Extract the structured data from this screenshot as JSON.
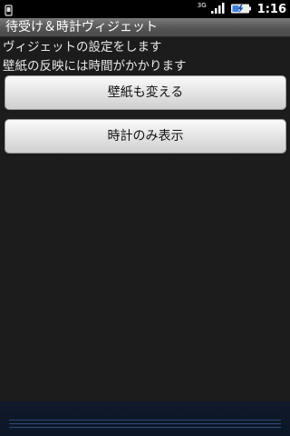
{
  "status_bar": {
    "network_type": "3G",
    "time": "1:16",
    "icons": [
      "notification-icon",
      "signal-icon",
      "battery-charging-icon"
    ]
  },
  "title": "待受け＆時計ヴィジェット",
  "description": {
    "line1": "ヴィジェットの設定をします",
    "line2": "壁紙の反映には時間がかかります"
  },
  "buttons": {
    "change_wallpaper": "壁紙も変える",
    "clock_only": "時計のみ表示"
  }
}
